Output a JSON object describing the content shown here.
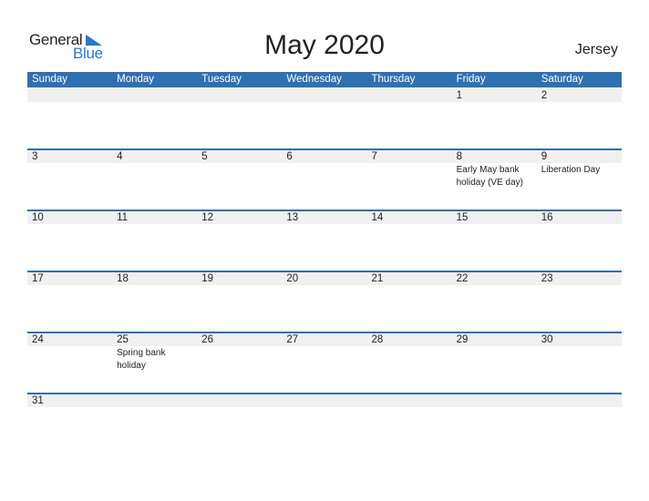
{
  "logo": {
    "word1": "General",
    "word2": "Blue"
  },
  "title": "May 2020",
  "country": "Jersey",
  "colors": {
    "header_bg": "#2f70b1",
    "brand_blue": "#2a78c4",
    "row_band": "#f0f0f0"
  },
  "weekdays": [
    "Sunday",
    "Monday",
    "Tuesday",
    "Wednesday",
    "Thursday",
    "Friday",
    "Saturday"
  ],
  "weeks": [
    [
      {
        "d": ""
      },
      {
        "d": ""
      },
      {
        "d": ""
      },
      {
        "d": ""
      },
      {
        "d": ""
      },
      {
        "d": "1"
      },
      {
        "d": "2"
      }
    ],
    [
      {
        "d": "3"
      },
      {
        "d": "4"
      },
      {
        "d": "5"
      },
      {
        "d": "6"
      },
      {
        "d": "7"
      },
      {
        "d": "8",
        "h": "Early May bank holiday (VE day)"
      },
      {
        "d": "9",
        "h": "Liberation Day"
      }
    ],
    [
      {
        "d": "10"
      },
      {
        "d": "11"
      },
      {
        "d": "12"
      },
      {
        "d": "13"
      },
      {
        "d": "14"
      },
      {
        "d": "15"
      },
      {
        "d": "16"
      }
    ],
    [
      {
        "d": "17"
      },
      {
        "d": "18"
      },
      {
        "d": "19"
      },
      {
        "d": "20"
      },
      {
        "d": "21"
      },
      {
        "d": "22"
      },
      {
        "d": "23"
      }
    ],
    [
      {
        "d": "24"
      },
      {
        "d": "25",
        "h": "Spring bank holiday"
      },
      {
        "d": "26"
      },
      {
        "d": "27"
      },
      {
        "d": "28"
      },
      {
        "d": "29"
      },
      {
        "d": "30"
      }
    ],
    [
      {
        "d": "31"
      },
      {
        "d": ""
      },
      {
        "d": ""
      },
      {
        "d": ""
      },
      {
        "d": ""
      },
      {
        "d": ""
      },
      {
        "d": ""
      }
    ]
  ]
}
